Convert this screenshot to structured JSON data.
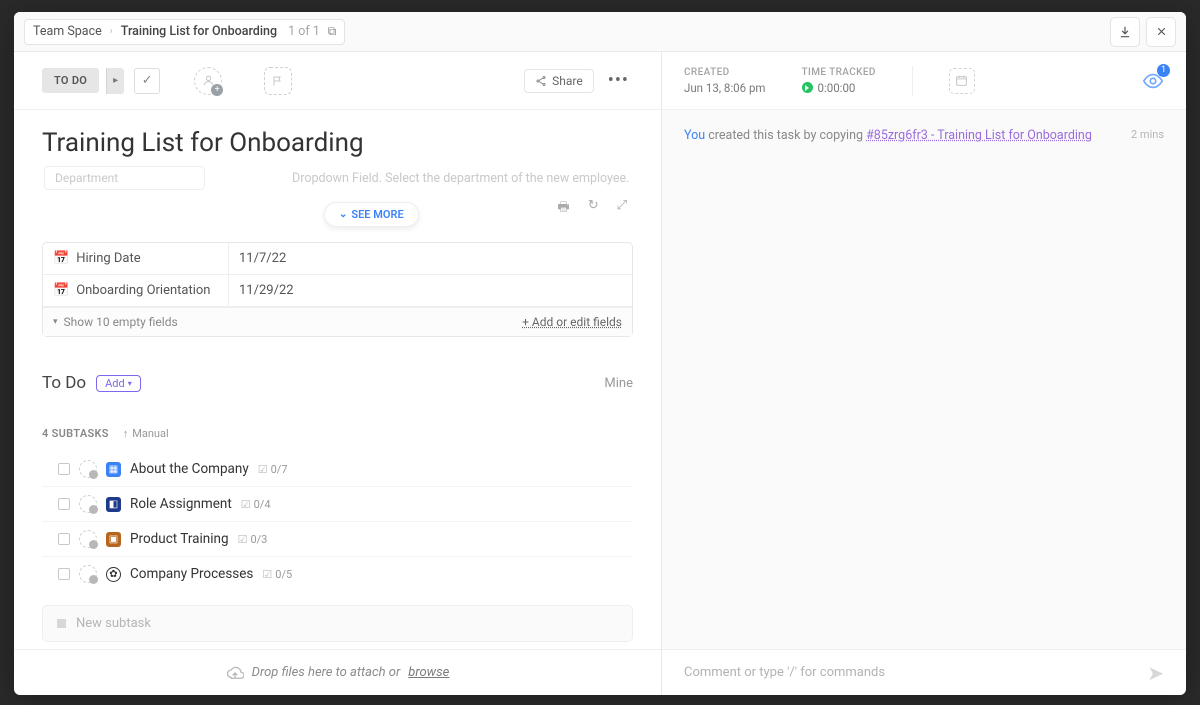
{
  "breadcrumb": {
    "space": "Team Space",
    "list": "Training List for Onboarding",
    "position": "1 of 1"
  },
  "toolbar": {
    "status": "TO DO",
    "share_label": "Share"
  },
  "task": {
    "title": "Training List for Onboarding",
    "hint_field": "Department",
    "hint_caption": "Dropdown Field. Select the department of the new employee.",
    "see_more": "SEE MORE"
  },
  "custom_fields": {
    "rows": [
      {
        "name": "Hiring Date",
        "value": "11/7/22"
      },
      {
        "name": "Onboarding Orientation",
        "value": "11/29/22"
      }
    ],
    "show_empty": "Show 10 empty fields",
    "add_edit": "+ Add or edit fields"
  },
  "todo_section": {
    "title": "To Do",
    "add": "Add",
    "mine": "Mine"
  },
  "subtasks": {
    "count_label": "4 SUBTASKS",
    "sort_label": "Manual",
    "items": [
      {
        "name": "About the Company",
        "progress": "0/7",
        "icon": "building"
      },
      {
        "name": "Role Assignment",
        "progress": "0/4",
        "icon": "role"
      },
      {
        "name": "Product Training",
        "progress": "0/3",
        "icon": "box"
      },
      {
        "name": "Company Processes",
        "progress": "0/5",
        "icon": "gear"
      }
    ],
    "new_placeholder": "New subtask"
  },
  "dropzone": {
    "text": "Drop files here to attach or",
    "browse": "browse"
  },
  "meta": {
    "created_label": "CREATED",
    "created_value": "Jun 13, 8:06 pm",
    "time_label": "TIME TRACKED",
    "time_value": "0:00:00",
    "watchers": "1"
  },
  "activity": {
    "actor": "You",
    "action": " created this task by copying ",
    "ref": "#85zrg6fr3 - Training List for Onboarding",
    "ago": "2 mins"
  },
  "comment": {
    "placeholder": "Comment or type '/' for commands"
  }
}
